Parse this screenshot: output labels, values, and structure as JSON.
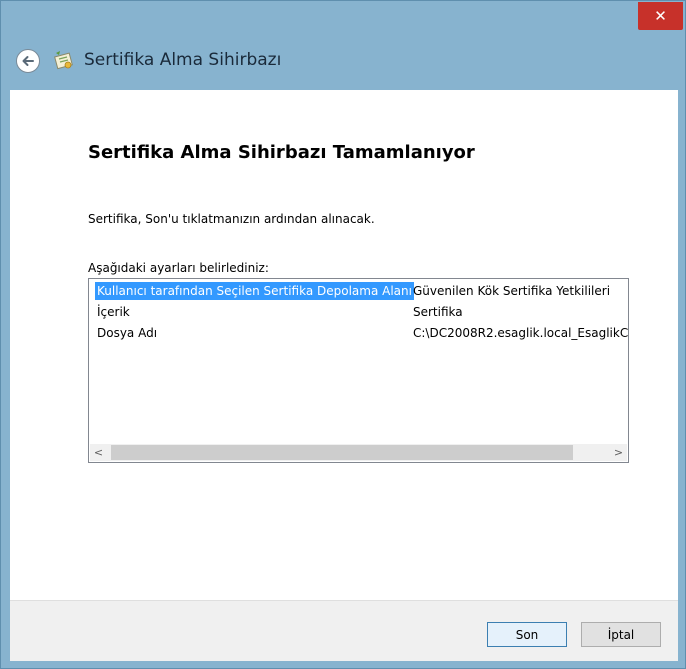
{
  "window": {
    "close_glyph": "✕",
    "title": "Sertifika Alma Sihirbazı"
  },
  "page": {
    "heading": "Sertifika Alma Sihirbazı Tamamlanıyor",
    "description": "Sertifika, Son'u tıklatmanızın ardından alınacak.",
    "settings_label": "Aşağıdaki ayarları belirlediniz:"
  },
  "settings_list": {
    "rows": [
      {
        "key": "Kullanıcı tarafından Seçilen Sertifika Depolama Alanı",
        "value": "Güvenilen Kök Sertifika Yetkilileri",
        "selected": true
      },
      {
        "key": "İçerik",
        "value": "Sertifika",
        "selected": false
      },
      {
        "key": "Dosya Adı",
        "value": "C:\\DC2008R2.esaglik.local_EsaglikC",
        "selected": false
      }
    ],
    "scroll_left": "<",
    "scroll_right": ">"
  },
  "footer": {
    "finish_label": "Son",
    "cancel_label": "İptal"
  },
  "colors": {
    "frame": "#87b3cf",
    "close": "#c7312a",
    "selection": "#3399ff"
  },
  "icons": {
    "back": "back-arrow-icon",
    "app": "certificate-wizard-icon",
    "close": "close-icon"
  }
}
